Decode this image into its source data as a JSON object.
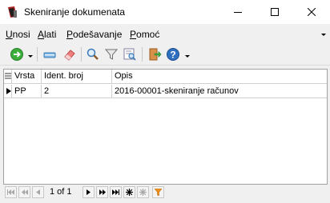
{
  "window": {
    "title": "Skeniranje dokumenata",
    "icon": "scanner-app-icon"
  },
  "menu": {
    "items": [
      {
        "label": "Unosi",
        "underline": "U",
        "rest": "nosi"
      },
      {
        "label": "Alati",
        "underline": "A",
        "rest": "lati"
      },
      {
        "label": "Podešavanje",
        "underline": "P",
        "rest": "odešavanje"
      },
      {
        "label": "Pomoć",
        "underline": "P",
        "rest": "omoć"
      }
    ]
  },
  "toolbar": {
    "icons": [
      "add-green-circle-icon",
      "scanner-icon",
      "eraser-icon",
      "magnifier-icon",
      "filter-funnel-icon",
      "find-replace-icon",
      "exit-door-icon",
      "help-icon"
    ]
  },
  "grid": {
    "columns": [
      "Vrsta",
      "Ident. broj",
      "Opis"
    ],
    "rows": [
      {
        "vrsta": "PP",
        "ident": "2",
        "opis": "2016-00001-skeniranje računov"
      }
    ]
  },
  "navigator": {
    "position": "1 of 1"
  },
  "colors": {
    "accent_green": "#3cae3c",
    "help_blue": "#2f6fc0",
    "filter_orange": "#f0901c"
  }
}
